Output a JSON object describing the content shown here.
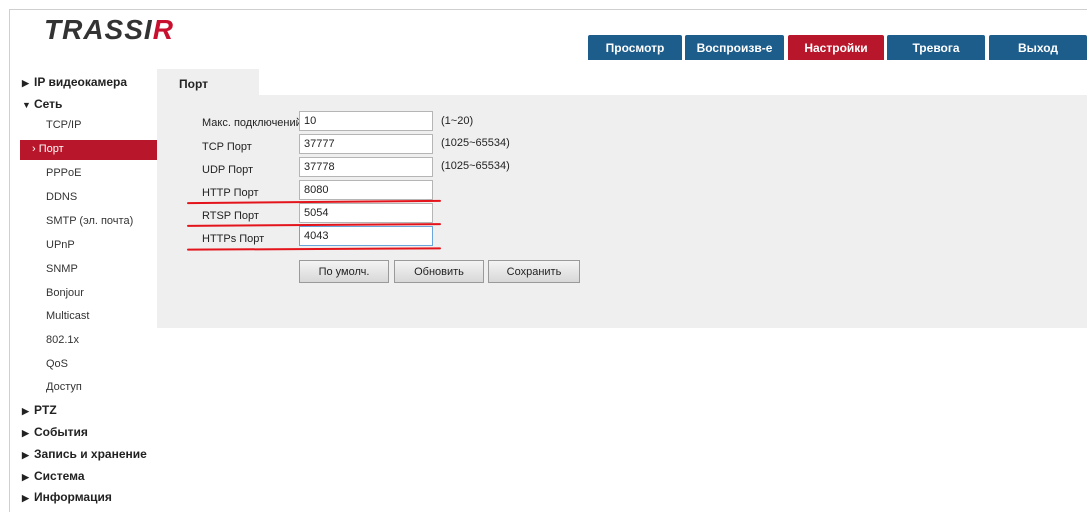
{
  "brand": {
    "logo_main": "TRASSI",
    "logo_accent": "R"
  },
  "tabs": [
    {
      "label": "Просмотр",
      "active": false
    },
    {
      "label": "Воспроизв-е",
      "active": false
    },
    {
      "label": "Настройки",
      "active": true
    },
    {
      "label": "Тревога",
      "active": false
    },
    {
      "label": "Выход",
      "active": false
    }
  ],
  "sidebar": {
    "groups": [
      {
        "label": "IP видеокамера",
        "expanded": false
      },
      {
        "label": "Сеть",
        "expanded": true
      },
      {
        "label": "PTZ",
        "expanded": false
      },
      {
        "label": "События",
        "expanded": false
      },
      {
        "label": "Запись и хранение",
        "expanded": false
      },
      {
        "label": "Система",
        "expanded": false
      },
      {
        "label": "Информация",
        "expanded": false
      }
    ],
    "net_items": [
      {
        "label": "TCP/IP"
      },
      {
        "label": "Порт",
        "active": true
      },
      {
        "label": "PPPoE"
      },
      {
        "label": "DDNS"
      },
      {
        "label": "SMTP (эл. почта)"
      },
      {
        "label": "UPnP"
      },
      {
        "label": "SNMP"
      },
      {
        "label": "Bonjour"
      },
      {
        "label": "Multicast"
      },
      {
        "label": "802.1x"
      },
      {
        "label": "QoS"
      },
      {
        "label": "Доступ"
      }
    ],
    "collapsed_icon": "▶",
    "expanded_icon": "▼",
    "active_arrow": "›"
  },
  "page": {
    "tab_label": "Порт",
    "fields": [
      {
        "label": "Макс. подключений",
        "value": "10",
        "hint": "(1~20)"
      },
      {
        "label": "TCP Порт",
        "value": "37777",
        "hint": "(1025~65534)"
      },
      {
        "label": "UDP Порт",
        "value": "37778",
        "hint": "(1025~65534)"
      },
      {
        "label": "HTTP Порт",
        "value": "8080",
        "hint": ""
      },
      {
        "label": "RTSP Порт",
        "value": "5054",
        "hint": ""
      },
      {
        "label": "HTTPs Порт",
        "value": "4043",
        "hint": ""
      }
    ],
    "buttons": {
      "default": "По умолч.",
      "refresh": "Обновить",
      "save": "Сохранить"
    }
  },
  "colors": {
    "accent_red": "#b8162a",
    "tab_blue": "#1c5d8c",
    "annotation_red": "#e3141b"
  }
}
